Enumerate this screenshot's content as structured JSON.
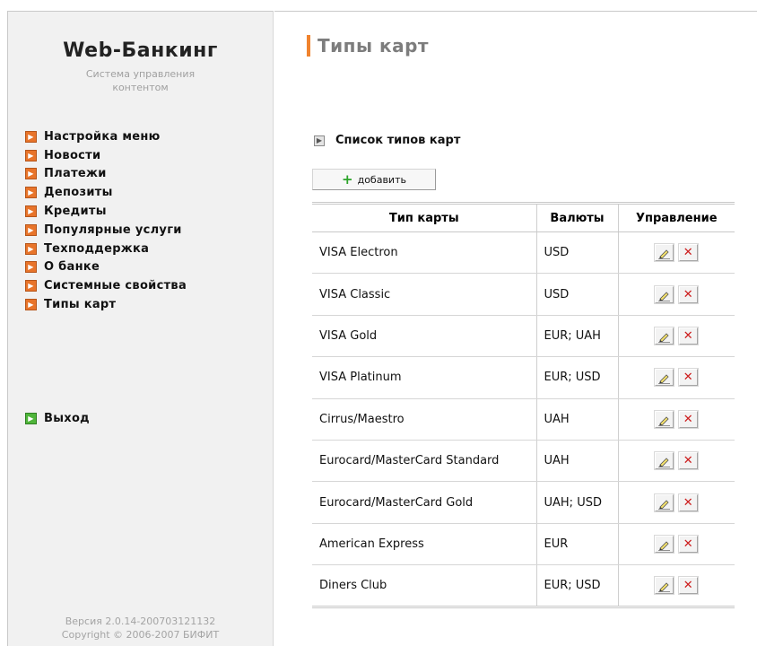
{
  "brand": {
    "title": "Web-Банкинг",
    "subtitle": "Система управления контентом"
  },
  "menu": {
    "items": [
      {
        "label": "Настройка меню"
      },
      {
        "label": "Новости"
      },
      {
        "label": "Платежи"
      },
      {
        "label": "Депозиты"
      },
      {
        "label": "Кредиты"
      },
      {
        "label": "Популярные услуги"
      },
      {
        "label": "Техподдержка"
      },
      {
        "label": "О банке"
      },
      {
        "label": "Системные свойства"
      },
      {
        "label": "Типы карт"
      }
    ],
    "exit_label": "Выход"
  },
  "footer": {
    "version": "Версия 2.0.14-200703121132",
    "copyright": "Copyright © 2006-2007 БИФИТ"
  },
  "main": {
    "page_title": "Типы карт",
    "section_title": "Список типов карт",
    "add_button": "добавить",
    "table": {
      "headers": [
        "Тип карты",
        "Валюты",
        "Управление"
      ],
      "rows": [
        {
          "type": "VISA Electron",
          "currencies": "USD"
        },
        {
          "type": "VISA Classic",
          "currencies": "USD"
        },
        {
          "type": "VISA Gold",
          "currencies": "EUR; UAH"
        },
        {
          "type": "VISA Platinum",
          "currencies": "EUR; USD"
        },
        {
          "type": "Cirrus/Maestro",
          "currencies": "UAH"
        },
        {
          "type": "Eurocard/MasterCard Standard",
          "currencies": "UAH"
        },
        {
          "type": "Eurocard/MasterCard Gold",
          "currencies": "UAH; USD"
        },
        {
          "type": "American Express",
          "currencies": "EUR"
        },
        {
          "type": "Diners Club",
          "currencies": "EUR; USD"
        }
      ]
    }
  },
  "icons": {
    "menu_bullet": "orange-arrow-icon",
    "exit_bullet": "green-arrow-icon",
    "edit": "pencil-icon",
    "delete": "red-x-icon"
  },
  "colors": {
    "accent": "#f0832e",
    "menu_bullet": "#e8742a",
    "exit_bullet": "#4fb53a",
    "delete": "#cc1a1a",
    "add_plus": "#2da42a"
  }
}
